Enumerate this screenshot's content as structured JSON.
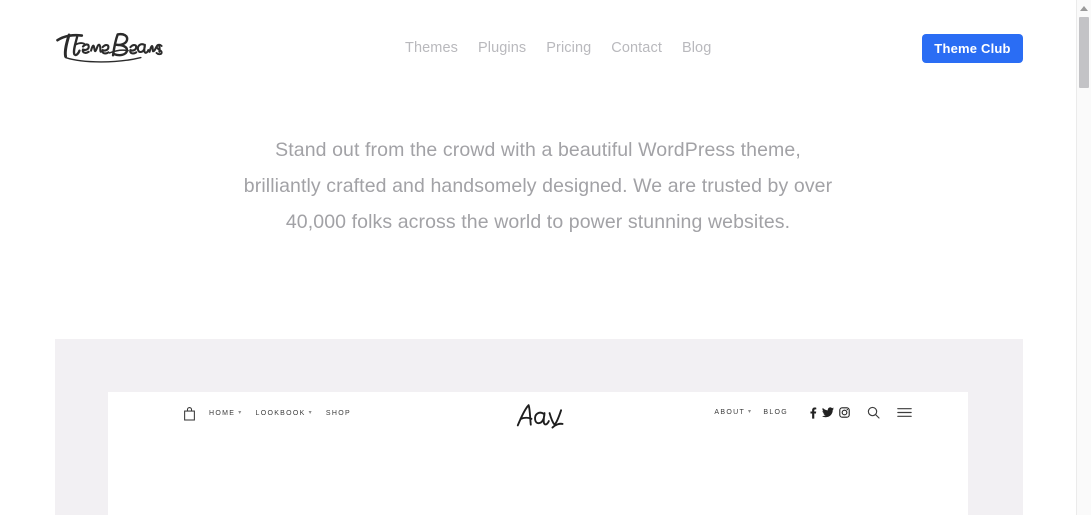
{
  "site": {
    "brand": {
      "name": "ThemeBeans",
      "icon": "script-wordmark-logo"
    },
    "nav": {
      "items": [
        {
          "label": "Themes",
          "name": "nav-link-themes"
        },
        {
          "label": "Plugins",
          "name": "nav-link-plugins"
        },
        {
          "label": "Pricing",
          "name": "nav-link-pricing"
        },
        {
          "label": "Contact",
          "name": "nav-link-contact"
        },
        {
          "label": "Blog",
          "name": "nav-link-blog"
        }
      ]
    },
    "cta": {
      "label": "Theme Club",
      "color": "#2a6df4",
      "text_color": "#ffffff"
    }
  },
  "hero": {
    "paragraph": "Stand out from the crowd with a beautiful WordPress theme, brilliantly crafted and handsomely designed. We are trusted by over 40,000 folks across the world to power stunning websites.",
    "text_color": "#a2a2a6"
  },
  "showcase": {
    "panel_color": "#f2f0f3",
    "browser_background": "#ffffff",
    "preview": {
      "logo": "Ava",
      "logo_icon": "handwritten-script-logo",
      "cart_icon": "shopping-bag-icon",
      "left_links": [
        {
          "label": "HOME",
          "has_caret": true
        },
        {
          "label": "LOOKBOOK",
          "has_caret": true
        },
        {
          "label": "SHOP",
          "has_caret": false
        }
      ],
      "right_links": [
        {
          "label": "ABOUT",
          "has_caret": true
        },
        {
          "label": "BLOG",
          "has_caret": false
        }
      ],
      "social_icons": [
        {
          "name": "facebook-icon"
        },
        {
          "name": "twitter-icon"
        },
        {
          "name": "instagram-icon"
        }
      ],
      "tool_icons": [
        {
          "name": "search-icon"
        },
        {
          "name": "hamburger-menu-icon"
        }
      ]
    }
  },
  "scrollbar": {
    "up_arrow": "scroll-up-arrow",
    "thumb_color": "#c3c3c6",
    "track_color": "#fafafa"
  }
}
